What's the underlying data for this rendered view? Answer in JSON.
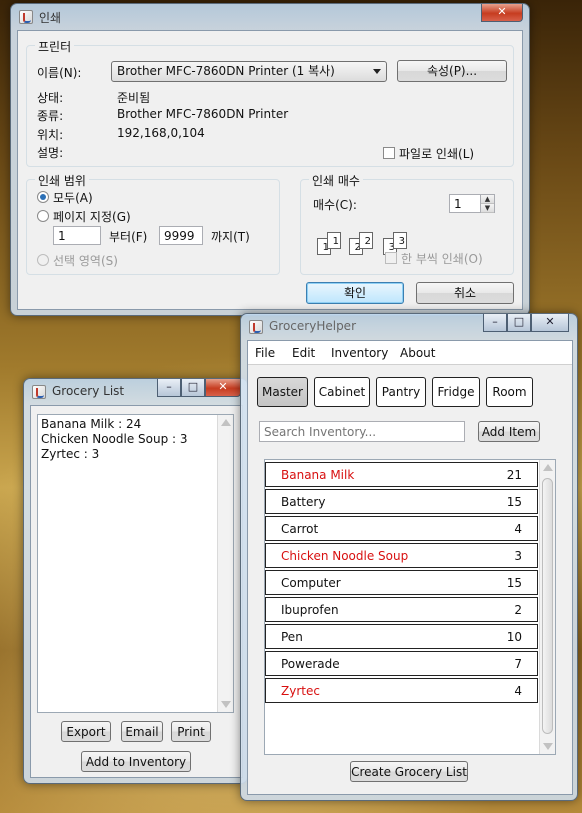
{
  "print_dialog": {
    "title": "인쇄",
    "printer_group": "프린터",
    "name_label": "이름(N):",
    "printer_name": "Brother MFC-7860DN Printer (1 복사)",
    "properties_button": "속성(P)...",
    "status_label": "상태:",
    "status_value": "준비됨",
    "type_label": "종류:",
    "type_value": "Brother MFC-7860DN Printer",
    "location_label": "위치:",
    "location_value": "192,168,0,104",
    "comment_label": "설명:",
    "print_to_file": "파일로 인쇄(L)",
    "range_group": "인쇄 범위",
    "all_label": "모두(A)",
    "pages_label": "페이지 지정(G)",
    "from_value": "1",
    "from_label": "부터(F)",
    "to_value": "9999",
    "to_label": "까지(T)",
    "selection_label": "선택 영역(S)",
    "copies_group": "인쇄 매수",
    "copies_label": "매수(C):",
    "copies_value": "1",
    "collate_label": "한 부씩 인쇄(O)",
    "collate_sheets": [
      "1",
      "1",
      "2",
      "2",
      "3",
      "3"
    ],
    "ok_button": "확인",
    "cancel_button": "취소"
  },
  "grocery_list": {
    "title": "Grocery List",
    "lines": [
      "Banana Milk : 24",
      "Chicken Noodle Soup : 3",
      "Zyrtec : 3"
    ],
    "export_button": "Export",
    "email_button": "Email",
    "print_button": "Print",
    "add_button": "Add to Inventory"
  },
  "grocery_helper": {
    "title": "GroceryHelper",
    "menu": [
      "File",
      "Edit",
      "Inventory",
      "About"
    ],
    "tabs": [
      "Master",
      "Cabinet",
      "Pantry",
      "Fridge",
      "Room"
    ],
    "active_tab": "Master",
    "search_placeholder": "Search Inventory...",
    "add_item_button": "Add Item",
    "items": [
      {
        "name": "Banana Milk",
        "qty": "21",
        "low": true
      },
      {
        "name": "Battery",
        "qty": "15",
        "low": false
      },
      {
        "name": "Carrot",
        "qty": "4",
        "low": false
      },
      {
        "name": "Chicken Noodle Soup",
        "qty": "3",
        "low": true
      },
      {
        "name": "Computer",
        "qty": "15",
        "low": false
      },
      {
        "name": "Ibuprofen",
        "qty": "2",
        "low": false
      },
      {
        "name": "Pen",
        "qty": "10",
        "low": false
      },
      {
        "name": "Powerade",
        "qty": "7",
        "low": false
      },
      {
        "name": "Zyrtec",
        "qty": "4",
        "low": true
      }
    ],
    "create_button": "Create Grocery List"
  },
  "colors": {
    "highlight_red": "#d81010",
    "active_tab": "#c8c8c8"
  }
}
